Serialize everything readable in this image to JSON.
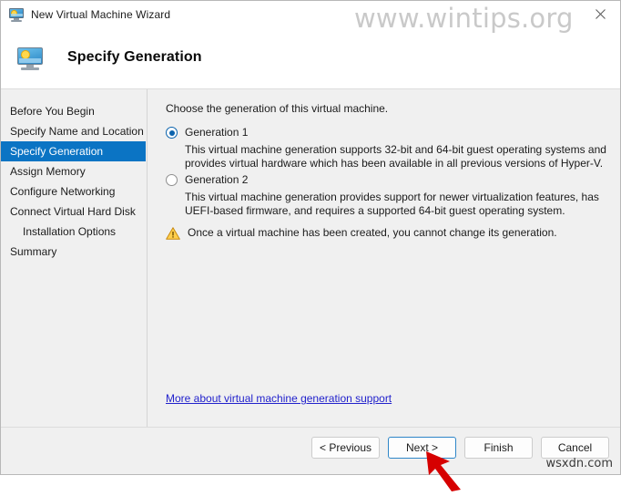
{
  "window": {
    "title": "New Virtual Machine Wizard",
    "title_icon": "virtual-machine-monitor-icon",
    "close_label": "✕"
  },
  "header": {
    "title": "Specify Generation",
    "icon": "virtual-machine-monitor-icon"
  },
  "sidebar": {
    "items": [
      {
        "label": "Before You Begin",
        "selected": false,
        "indent": false
      },
      {
        "label": "Specify Name and Location",
        "selected": false,
        "indent": false
      },
      {
        "label": "Specify Generation",
        "selected": true,
        "indent": false
      },
      {
        "label": "Assign Memory",
        "selected": false,
        "indent": false
      },
      {
        "label": "Configure Networking",
        "selected": false,
        "indent": false
      },
      {
        "label": "Connect Virtual Hard Disk",
        "selected": false,
        "indent": false
      },
      {
        "label": "Installation Options",
        "selected": false,
        "indent": true
      },
      {
        "label": "Summary",
        "selected": false,
        "indent": false
      }
    ]
  },
  "main": {
    "intro": "Choose the generation of this virtual machine.",
    "options": [
      {
        "label": "Generation 1",
        "selected": true,
        "description": "This virtual machine generation supports 32-bit and 64-bit guest operating systems and provides virtual hardware which has been available in all previous versions of Hyper-V."
      },
      {
        "label": "Generation 2",
        "selected": false,
        "description": "This virtual machine generation provides support for newer virtualization features, has UEFI-based firmware, and requires a supported 64-bit guest operating system."
      }
    ],
    "warning": {
      "icon": "warning-triangle-icon",
      "text": "Once a virtual machine has been created, you cannot change its generation."
    },
    "link": "More about virtual machine generation support"
  },
  "footer": {
    "buttons": [
      {
        "label": "< Previous",
        "default": false
      },
      {
        "label": "Next >",
        "default": true
      },
      {
        "label": "Finish",
        "default": false
      },
      {
        "label": "Cancel",
        "default": false
      }
    ]
  },
  "watermarks": {
    "top": "www.wintips.org",
    "bottom": "wsxdn.com"
  },
  "colors": {
    "accent_selection": "#0b74c4",
    "radio_accent": "#0b63ad",
    "link": "#2222cc",
    "warning": "#f0b429",
    "default_button_border": "#2e86c8",
    "pointer_arrow": "#d60000"
  }
}
